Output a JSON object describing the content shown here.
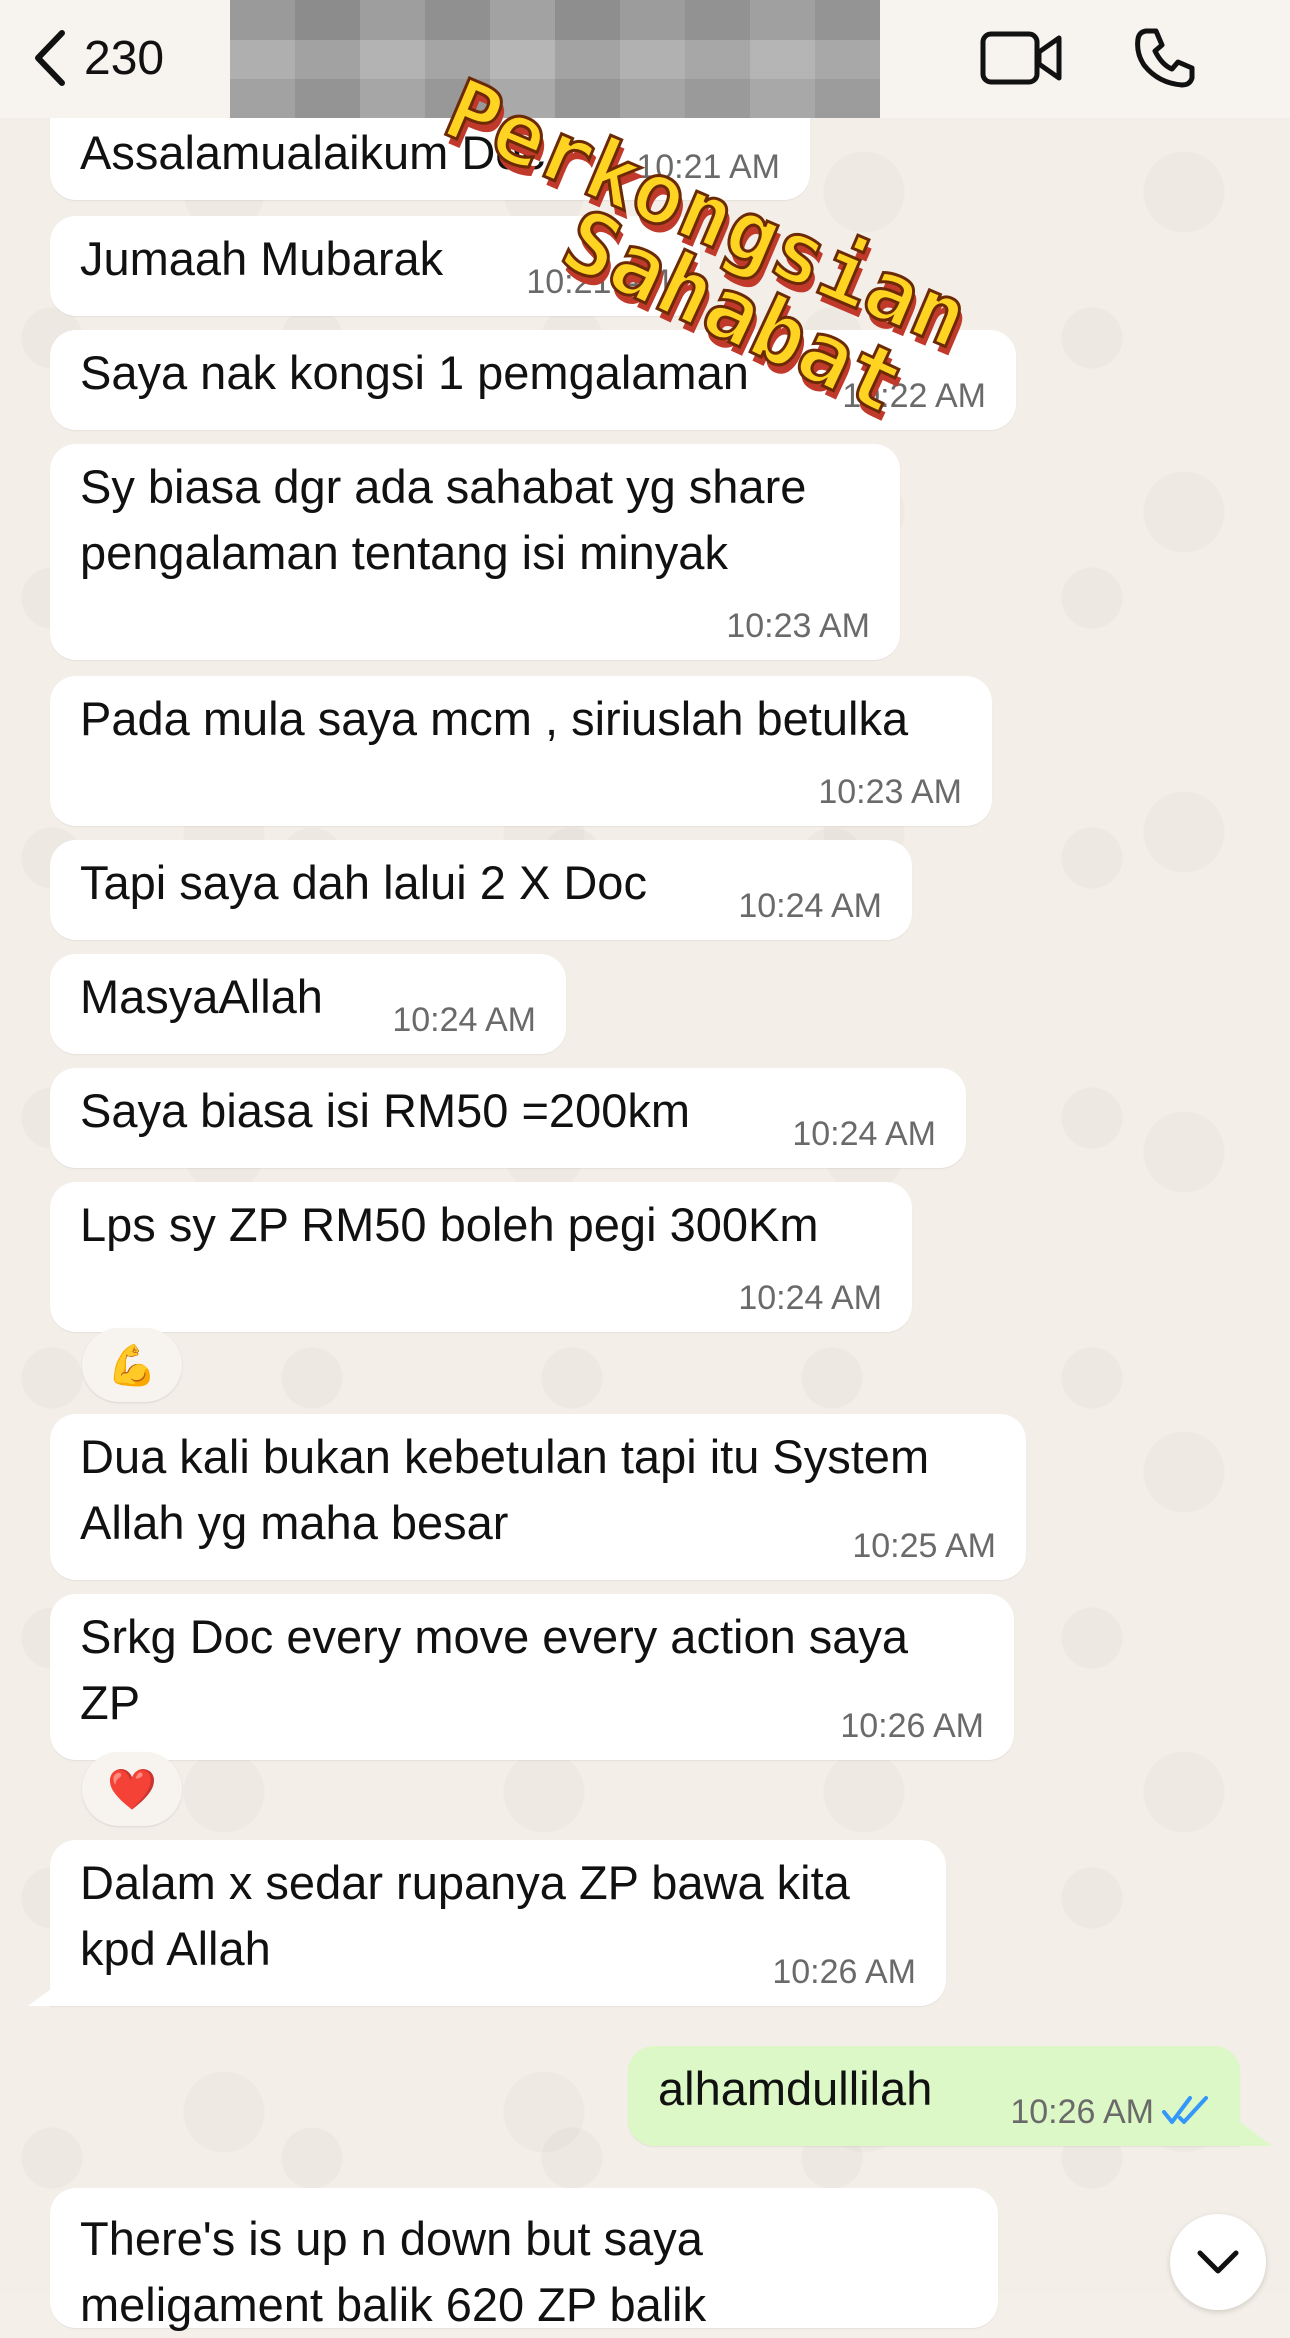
{
  "header": {
    "back_count": "230"
  },
  "watermark": {
    "line1": "Perkongsian",
    "line2": "Sahabat"
  },
  "messages": [
    {
      "text": "Assalamualaikum Doc,",
      "time": "10:21 AM"
    },
    {
      "text": "Jumaah Mubarak",
      "time": "10:21 AM"
    },
    {
      "text": "Saya nak kongsi 1 pemgalaman",
      "time": "10:22 AM"
    },
    {
      "text": "Sy biasa dgr ada sahabat yg share\npengalaman tentang isi minyak",
      "time": "10:23 AM"
    },
    {
      "text": "Pada mula saya mcm , siriuslah betulka",
      "time": "10:23 AM"
    },
    {
      "text": "Tapi saya dah lalui 2 X Doc",
      "time": "10:24 AM"
    },
    {
      "text": "MasyaAllah",
      "time": "10:24 AM"
    },
    {
      "text": "Saya biasa isi RM50 =200km",
      "time": "10:24 AM"
    },
    {
      "text": "Lps sy ZP RM50 boleh pegi 300Km",
      "time": "10:24 AM",
      "reaction": "💪"
    },
    {
      "text": "Dua kali bukan kebetulan tapi itu System\nAllah yg maha besar",
      "time": "10:25 AM"
    },
    {
      "text": "Srkg Doc every move every action saya\nZP",
      "time": "10:26 AM",
      "reaction": "❤️"
    },
    {
      "text": "Dalam x sedar rupanya ZP bawa kita\nkpd Allah",
      "time": "10:26 AM"
    },
    {
      "text": "alhamdullilah",
      "time": "10:26 AM",
      "outgoing": true,
      "status": "read"
    },
    {
      "text": "There's is up n down but saya\nmeligament balik 620 ZP balik",
      "time": ""
    }
  ],
  "colors": {
    "incoming_bubble": "#ffffff",
    "outgoing_bubble": "#dcf8c6",
    "read_ticks": "#3497f9"
  },
  "icons": {
    "back": "chevron-left-icon",
    "video": "video-camera-icon",
    "call": "phone-icon",
    "scroll": "chevron-down-icon",
    "read": "double-check-icon"
  }
}
